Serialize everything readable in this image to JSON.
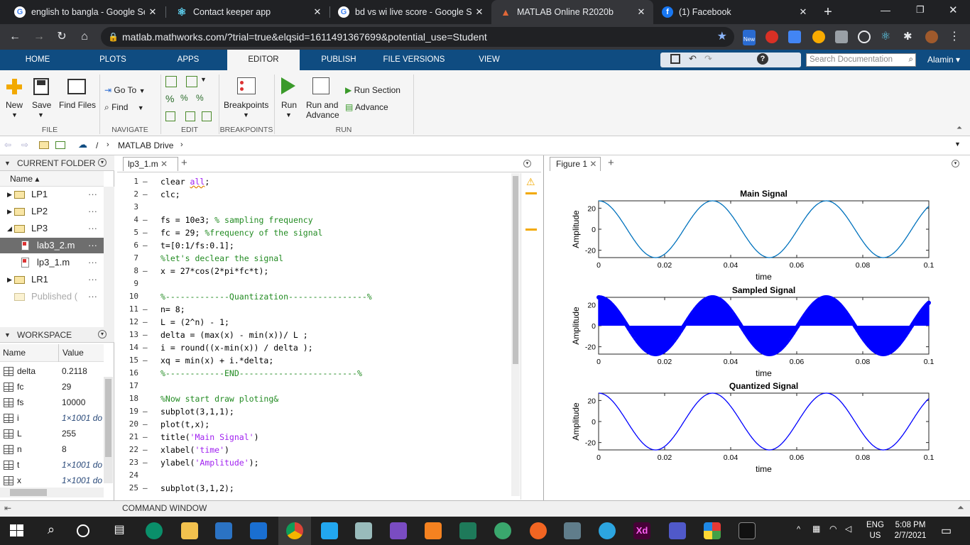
{
  "browser": {
    "tabs": [
      {
        "title": "english to bangla - Google Sea",
        "icon": "google-icon",
        "color": "#ffffff"
      },
      {
        "title": "Contact keeper app",
        "icon": "react-icon",
        "color": "#61dafb"
      },
      {
        "title": "bd vs wi live score - Google Se",
        "icon": "google-icon",
        "color": "#ffffff"
      },
      {
        "title": "MATLAB Online R2020b",
        "icon": "matlab-icon",
        "color": "#e16737"
      },
      {
        "title": "(1) Facebook",
        "icon": "facebook-icon",
        "color": "#1877f2"
      }
    ],
    "url": "matlab.mathworks.com/?trial=true&elqsid=1611491367699&potential_use=Student",
    "new_badge": "New"
  },
  "matlab": {
    "tabs": [
      "HOME",
      "PLOTS",
      "APPS",
      "EDITOR",
      "PUBLISH",
      "FILE VERSIONS",
      "VIEW"
    ],
    "search_placeholder": "Search Documentation",
    "user": "Alamin",
    "toolstrip": {
      "new": "New",
      "save": "Save",
      "find_files": "Find Files",
      "go_to": "Go To",
      "find": "Find",
      "breakpoints": "Breakpoints",
      "run": "Run",
      "run_and": "Run and",
      "advance_line": "Advance",
      "run_section": "Run Section",
      "advance": "Advance",
      "sections": [
        "FILE",
        "NAVIGATE",
        "EDIT",
        "BREAKPOINTS",
        "RUN"
      ]
    },
    "address": "MATLAB Drive",
    "current_folder": {
      "title": "CURRENT FOLDER",
      "col_name": "Name",
      "items": [
        {
          "name": "LP1",
          "type": "folder"
        },
        {
          "name": "LP2",
          "type": "folder"
        },
        {
          "name": "LP3",
          "type": "folder"
        },
        {
          "name": "lab3_2.m",
          "type": "file"
        },
        {
          "name": "lp3_1.m",
          "type": "file"
        },
        {
          "name": "LR1",
          "type": "folder"
        },
        {
          "name": "Published (",
          "type": "folder"
        }
      ]
    },
    "workspace": {
      "title": "WORKSPACE",
      "col_name": "Name",
      "col_value": "Value",
      "vars": [
        {
          "name": "delta",
          "value": "0.2118"
        },
        {
          "name": "fc",
          "value": "29"
        },
        {
          "name": "fs",
          "value": "10000"
        },
        {
          "name": "i",
          "value": "1×1001 do"
        },
        {
          "name": "L",
          "value": "255"
        },
        {
          "name": "n",
          "value": "8"
        },
        {
          "name": "t",
          "value": "1×1001 do"
        },
        {
          "name": "x",
          "value": "1×1001 do"
        }
      ]
    },
    "editor": {
      "tab": "lp3_1.m",
      "lines": [
        {
          "n": "1",
          "d": "–",
          "parts": [
            [
              "clear ",
              "c"
            ],
            [
              "all",
              "s"
            ],
            [
              ";",
              "c"
            ]
          ]
        },
        {
          "n": "2",
          "d": "–",
          "parts": [
            [
              "clc;",
              "c"
            ]
          ]
        },
        {
          "n": "3",
          "d": "",
          "parts": []
        },
        {
          "n": "4",
          "d": "–",
          "parts": [
            [
              "fs = 10e3; ",
              "c"
            ],
            [
              "% sampling frequency",
              "m"
            ]
          ]
        },
        {
          "n": "5",
          "d": "–",
          "parts": [
            [
              "fc = 29; ",
              "c"
            ],
            [
              "%frequency of the signal",
              "m"
            ]
          ]
        },
        {
          "n": "6",
          "d": "–",
          "parts": [
            [
              "t=[0:1/fs:0.1];",
              "c"
            ]
          ]
        },
        {
          "n": "7",
          "d": "",
          "parts": [
            [
              "%let's declear the signal",
              "m"
            ]
          ]
        },
        {
          "n": "8",
          "d": "–",
          "parts": [
            [
              "x = 27*cos(2*pi*fc*t);",
              "c"
            ]
          ]
        },
        {
          "n": "9",
          "d": "",
          "parts": []
        },
        {
          "n": "10",
          "d": "",
          "parts": [
            [
              "%-------------Quantization----------------%",
              "m"
            ]
          ]
        },
        {
          "n": "11",
          "d": "–",
          "parts": [
            [
              "n= 8;",
              "c"
            ]
          ]
        },
        {
          "n": "12",
          "d": "–",
          "parts": [
            [
              "L = (2^n) - 1;",
              "c"
            ]
          ]
        },
        {
          "n": "13",
          "d": "–",
          "parts": [
            [
              "delta = (max(x) - min(x))/ L ;",
              "c"
            ]
          ]
        },
        {
          "n": "14",
          "d": "–",
          "parts": [
            [
              "i = round((x-min(x)) / delta );",
              "c"
            ]
          ]
        },
        {
          "n": "15",
          "d": "–",
          "parts": [
            [
              "xq = min(x) + i.*delta;",
              "c"
            ]
          ]
        },
        {
          "n": "16",
          "d": "",
          "parts": [
            [
              "%------------END------------------------%",
              "m"
            ]
          ]
        },
        {
          "n": "17",
          "d": "",
          "parts": []
        },
        {
          "n": "18",
          "d": "",
          "parts": [
            [
              "%Now start draw ploting&",
              "m"
            ]
          ]
        },
        {
          "n": "19",
          "d": "–",
          "parts": [
            [
              "subplot(3,1,1);",
              "c"
            ]
          ]
        },
        {
          "n": "20",
          "d": "–",
          "parts": [
            [
              "plot(t,x);",
              "c"
            ]
          ]
        },
        {
          "n": "21",
          "d": "–",
          "parts": [
            [
              "title(",
              "c"
            ],
            [
              "'Main Signal'",
              "s"
            ],
            [
              ")",
              "c"
            ]
          ]
        },
        {
          "n": "22",
          "d": "–",
          "parts": [
            [
              "xlabel(",
              "c"
            ],
            [
              "'time'",
              "s"
            ],
            [
              ")",
              "c"
            ]
          ]
        },
        {
          "n": "23",
          "d": "–",
          "parts": [
            [
              "ylabel(",
              "c"
            ],
            [
              "'Amplitude'",
              "s"
            ],
            [
              ");",
              "c"
            ]
          ]
        },
        {
          "n": "24",
          "d": "",
          "parts": []
        },
        {
          "n": "25",
          "d": "–",
          "parts": [
            [
              "subplot(3,1,2);",
              "c"
            ]
          ]
        }
      ]
    },
    "figure": {
      "tab": "Figure 1"
    },
    "command_window": "COMMAND WINDOW"
  },
  "chart_data": [
    {
      "type": "line",
      "title": "Main Signal",
      "xlabel": "time",
      "ylabel": "Amplitude",
      "xlim": [
        0,
        0.1
      ],
      "ylim": [
        -27,
        27
      ],
      "xticks": [
        "0",
        "0.02",
        "0.04",
        "0.06",
        "0.08",
        "0.1"
      ],
      "yticks": [
        "20",
        "0",
        "-20"
      ],
      "color": "#0072bd",
      "function": "27*cos(2*pi*29*t)",
      "style": "line"
    },
    {
      "type": "line",
      "title": "Sampled Signal",
      "xlabel": "time",
      "ylabel": "Amplitude",
      "xlim": [
        0,
        0.1
      ],
      "ylim": [
        -27,
        27
      ],
      "xticks": [
        "0",
        "0.02",
        "0.04",
        "0.06",
        "0.08",
        "0.1"
      ],
      "yticks": [
        "20",
        "0",
        "-20"
      ],
      "color": "#0000ff",
      "function": "27*cos(2*pi*29*t)",
      "style": "stem"
    },
    {
      "type": "line",
      "title": "Quantized Signal",
      "xlabel": "time",
      "ylabel": "Amplitude",
      "xlim": [
        0,
        0.1
      ],
      "ylim": [
        -27,
        27
      ],
      "xticks": [
        "0",
        "0.02",
        "0.04",
        "0.06",
        "0.08",
        "0.1"
      ],
      "yticks": [
        "20",
        "0",
        "-20"
      ],
      "color": "#0000ff",
      "function": "27*cos(2*pi*29*t)",
      "style": "line"
    }
  ],
  "taskbar": {
    "lang": "ENG",
    "region": "US",
    "time": "5:08 PM",
    "date": "2/7/2021"
  }
}
